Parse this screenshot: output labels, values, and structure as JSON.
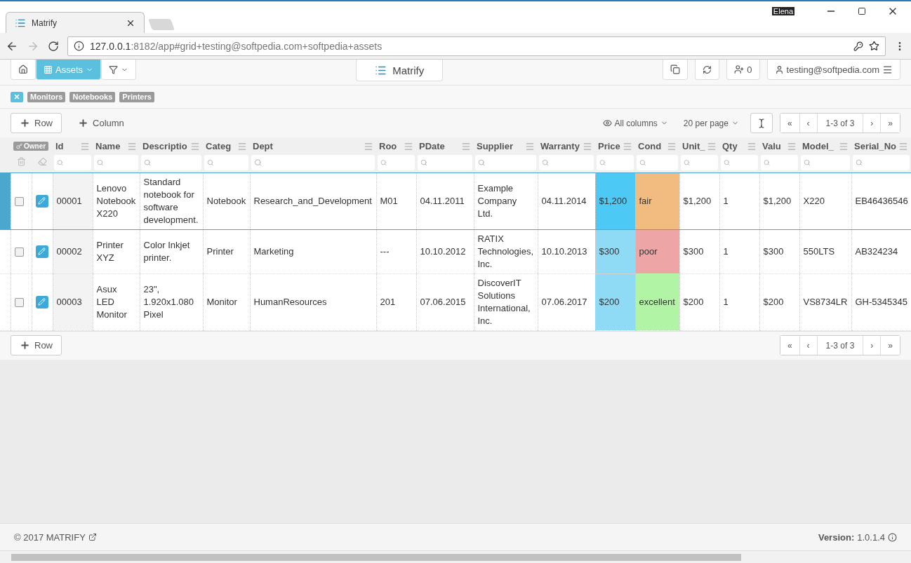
{
  "browser": {
    "tab_title": "Matrify",
    "profile_name": "Elena",
    "url_host": "127.0.0.1",
    "url_rest": ":8182/app#grid+testing@softpedia.com+softpedia+assets"
  },
  "nav": {
    "view_menu": {
      "label": "Assets",
      "selected": true
    },
    "title": "Matrify",
    "invite_count": "0",
    "user": "testing@softpedia.com"
  },
  "tags": [
    {
      "label": "Monitors",
      "selected": false
    },
    {
      "label": "Notebooks",
      "selected": false
    },
    {
      "label": "Printers",
      "selected": false
    }
  ],
  "toolbar": {
    "add_row": "Row",
    "add_column": "Column",
    "columns_menu": "All columns",
    "page_size": "20 per page"
  },
  "pagination": {
    "first": "«",
    "prev": "‹",
    "range": "1-3 of 3",
    "next": "›",
    "last": "»"
  },
  "table": {
    "owner_label": "Owner",
    "columns": [
      {
        "label": "Id",
        "kind": "id"
      },
      {
        "label": "Name",
        "kind": "text"
      },
      {
        "label": "Descriptio",
        "kind": "text"
      },
      {
        "label": "Categ",
        "kind": "text"
      },
      {
        "label": "Dept",
        "kind": "text"
      },
      {
        "label": "Roo",
        "kind": "text"
      },
      {
        "label": "PDate",
        "kind": "text"
      },
      {
        "label": "Supplier",
        "kind": "text"
      },
      {
        "label": "Warranty",
        "kind": "text"
      },
      {
        "label": "Price",
        "kind": "text"
      },
      {
        "label": "Cond",
        "kind": "text"
      },
      {
        "label": "Unit_",
        "kind": "text"
      },
      {
        "label": "Qty",
        "kind": "text"
      },
      {
        "label": "Valu",
        "kind": "text"
      },
      {
        "label": "Model_",
        "kind": "text"
      },
      {
        "label": "Serial_No",
        "kind": "text"
      }
    ],
    "rows": [
      {
        "selected": true,
        "checked": false,
        "cells": [
          {
            "text": "00001"
          },
          {
            "text": "Lenovo Notebook X220"
          },
          {
            "text": "Standard notebook for software development."
          },
          {
            "text": "Notebook"
          },
          {
            "text": "Research_and_Development"
          },
          {
            "text": "M01"
          },
          {
            "text": "04.11.2011"
          },
          {
            "text": "Example Company Ltd."
          },
          {
            "text": "04.11.2014"
          },
          {
            "text": "$1,200",
            "color": "#4ccaf5"
          },
          {
            "text": "fair",
            "color": "#f2bc80"
          },
          {
            "text": "$1,200"
          },
          {
            "text": "1"
          },
          {
            "text": "$1,200"
          },
          {
            "text": "X220"
          },
          {
            "text": "EB46436546"
          }
        ]
      },
      {
        "selected": false,
        "checked": false,
        "cells": [
          {
            "text": "00002"
          },
          {
            "text": "Printer XYZ"
          },
          {
            "text": "Color Inkjet printer."
          },
          {
            "text": "Printer"
          },
          {
            "text": "Marketing"
          },
          {
            "text": "---"
          },
          {
            "text": "10.10.2012"
          },
          {
            "text": "RATIX Technologies, Inc."
          },
          {
            "text": "10.10.2013"
          },
          {
            "text": "$300",
            "color": "#8fdaf5"
          },
          {
            "text": "poor",
            "color": "#eea5a5"
          },
          {
            "text": "$300"
          },
          {
            "text": "1"
          },
          {
            "text": "$300"
          },
          {
            "text": "550LTS"
          },
          {
            "text": "AB324234"
          }
        ]
      },
      {
        "selected": false,
        "checked": false,
        "cells": [
          {
            "text": "00003"
          },
          {
            "text": "Asux LED Monitor"
          },
          {
            "text": "23\", 1.920x1.080 Pixel"
          },
          {
            "text": "Monitor"
          },
          {
            "text": "HumanResources"
          },
          {
            "text": "201"
          },
          {
            "text": "07.06.2015"
          },
          {
            "text": "DiscoverIT Solutions International, Inc."
          },
          {
            "text": "07.06.2017"
          },
          {
            "text": "$200",
            "color": "#8fdaf5"
          },
          {
            "text": "excellent",
            "color": "#b2f4a5"
          },
          {
            "text": "$200"
          },
          {
            "text": "1"
          },
          {
            "text": "$200"
          },
          {
            "text": "VS8734LR"
          },
          {
            "text": "GH-5345345"
          }
        ]
      }
    ]
  },
  "bottom": {
    "add_row": "Row",
    "pagination": {
      "first": "«",
      "prev": "‹",
      "range": "1-3 of 3",
      "next": "›",
      "last": "»"
    }
  },
  "footer": {
    "copyright": "© 2017 MATRIFY",
    "version_label": "Version:",
    "version": "1.0.1.4"
  }
}
